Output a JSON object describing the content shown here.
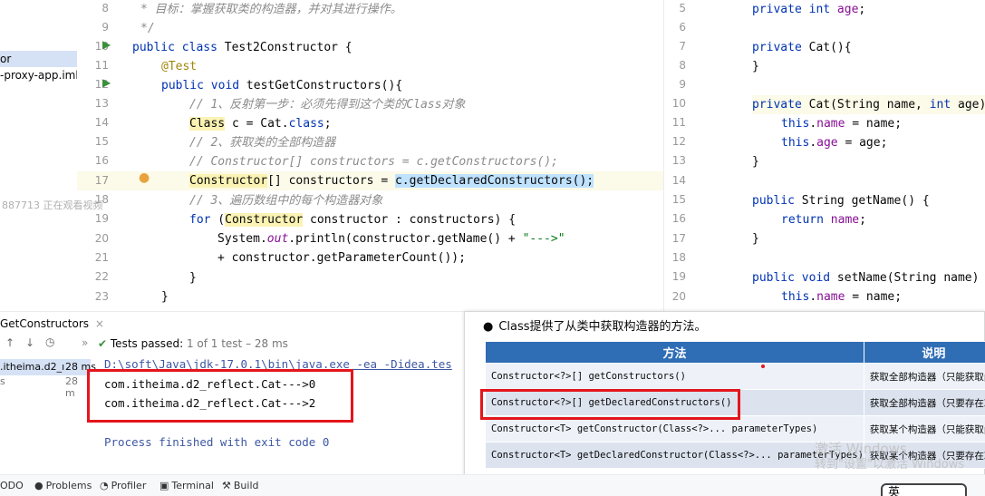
{
  "project_panel": {
    "items": [
      "or",
      "-proxy-app.iml"
    ]
  },
  "viewer_overlay": "887713 正在观看视频",
  "editor_left": {
    "lines": [
      {
        "num": "8",
        "html_id": "l8"
      },
      {
        "num": "9",
        "html_id": "l9"
      },
      {
        "num": "10",
        "html_id": "l10"
      },
      {
        "num": "11",
        "html_id": "l11"
      },
      {
        "num": "12",
        "html_id": "l12"
      },
      {
        "num": "13",
        "html_id": "l13"
      },
      {
        "num": "14",
        "html_id": "l14"
      },
      {
        "num": "15",
        "html_id": "l15"
      },
      {
        "num": "16",
        "html_id": "l16"
      },
      {
        "num": "17",
        "html_id": "l17"
      },
      {
        "num": "18",
        "html_id": "l18"
      },
      {
        "num": "19",
        "html_id": "l19"
      },
      {
        "num": "20",
        "html_id": "l20"
      },
      {
        "num": "21",
        "html_id": "l21"
      },
      {
        "num": "22",
        "html_id": "l22"
      },
      {
        "num": "23",
        "html_id": "l23"
      }
    ],
    "code": {
      "l8": "* 目标：掌握获取类的构造器，并对其进行操作。",
      "l9": "*/",
      "l10_kw": "public class",
      "l10_rest": " Test2Constructor {",
      "l11": "@Test",
      "l12_kw": "public void",
      "l12_rest": " testGetConstructors(){",
      "l13": "// 1、反射第一步：必须先得到这个类的Class对象",
      "l14_cls": "Class",
      "l14_mid": " c = Cat.",
      "l14_kw": "class",
      "l14_end": ";",
      "l15": "// 2、获取类的全部构造器",
      "l16": "// Constructor[] constructors = c.getConstructors();",
      "l17_a": "Constructor",
      "l17_b": "[] constructors = ",
      "l17_c": "c.getDeclaredConstructors();",
      "l18": "// 3、遍历数组中的每个构造器对象",
      "l19_kw": "for",
      "l19_b": " (",
      "l19_c": "Constructor",
      "l19_d": " constructor : constructors) {",
      "l20_a": "System.",
      "l20_b": "out",
      "l20_c": ".println(constructor.getName() + ",
      "l20_d": "\"--->\"",
      "l21": "+ constructor.getParameterCount());",
      "l22": "}",
      "l23": "}"
    }
  },
  "editor_right": {
    "line_numbers": [
      "5",
      "6",
      "7",
      "8",
      "9",
      "10",
      "11",
      "12",
      "13",
      "14",
      "15",
      "16",
      "17",
      "18",
      "19",
      "20"
    ],
    "code": {
      "r5_kw": "private int",
      "r5_f": " age",
      "r5_e": ";",
      "r7_kw": "private",
      "r7_rest": " Cat(){",
      "r8": "}",
      "r10_kw": "private",
      "r10_a": " Cat(String name, ",
      "r10_kw2": "int",
      "r10_b": " age)",
      "r11_kw": "this",
      "r11_a": ".",
      "r11_f": "name",
      "r11_b": " = name;",
      "r12_kw": "this",
      "r12_a": ".",
      "r12_f": "age",
      "r12_b": " = age;",
      "r13": "}",
      "r15_kw": "public",
      "r15_rest": " String getName() {",
      "r16_kw": "return",
      "r16_f": " name",
      "r16_e": ";",
      "r17": "}",
      "r19_kw": "public void",
      "r19_rest": " setName(String name)",
      "r20_kw": "this",
      "r20_a": ".",
      "r20_f": "name",
      "r20_b": " = name;"
    }
  },
  "run_panel": {
    "tab_label": "GetConstructors",
    "tests_passed_label": "Tests passed:",
    "tests_passed_detail": "1 of 1 test – 28 ms",
    "tree_item": ".itheima.d2_ı",
    "tree_time": "28 ms",
    "tree_time2": "28 m",
    "tree_item2": "s",
    "command_line": "D:\\soft\\Java\\jdk-17.0.1\\bin\\java.exe -ea -Didea.tes",
    "output": [
      "com.itheima.d2_reflect.Cat--->0",
      "com.itheima.d2_reflect.Cat--->2"
    ],
    "exit_message": "Process finished with exit code 0"
  },
  "slide": {
    "heading": "Class提供了从类中获取构造器的方法。",
    "table_headers": [
      "方法",
      "说明"
    ],
    "rows": [
      {
        "method": "Constructor<?>[] getConstructors()",
        "desc": "获取全部构造器（只能获取pub"
      },
      {
        "method": "Constructor<?>[] getDeclaredConstructors()",
        "desc": "获取全部构造器（只要存在就能"
      },
      {
        "method": "Constructor<T> getConstructor(Class<?>... parameterTypes)",
        "desc": "获取某个构造器（只能获取pub"
      },
      {
        "method": "Constructor<T> getDeclaredConstructor(Class<?>... parameterTypes)",
        "desc": "获取某个构造器（只要存在就能"
      }
    ]
  },
  "watermark": {
    "line1": "激活 Windows",
    "line2": "转到\"设置\"以激活 Windows"
  },
  "status_bar": {
    "items": [
      "ODO",
      "Problems",
      "Profiler",
      "Terminal",
      "Build"
    ]
  },
  "ime_label": "英",
  "colors": {
    "accent_blue": "#2f6db5",
    "annotation_red": "#e4151c",
    "keyword": "#0033b3",
    "comment": "#8c8c8c",
    "string": "#067d17"
  }
}
